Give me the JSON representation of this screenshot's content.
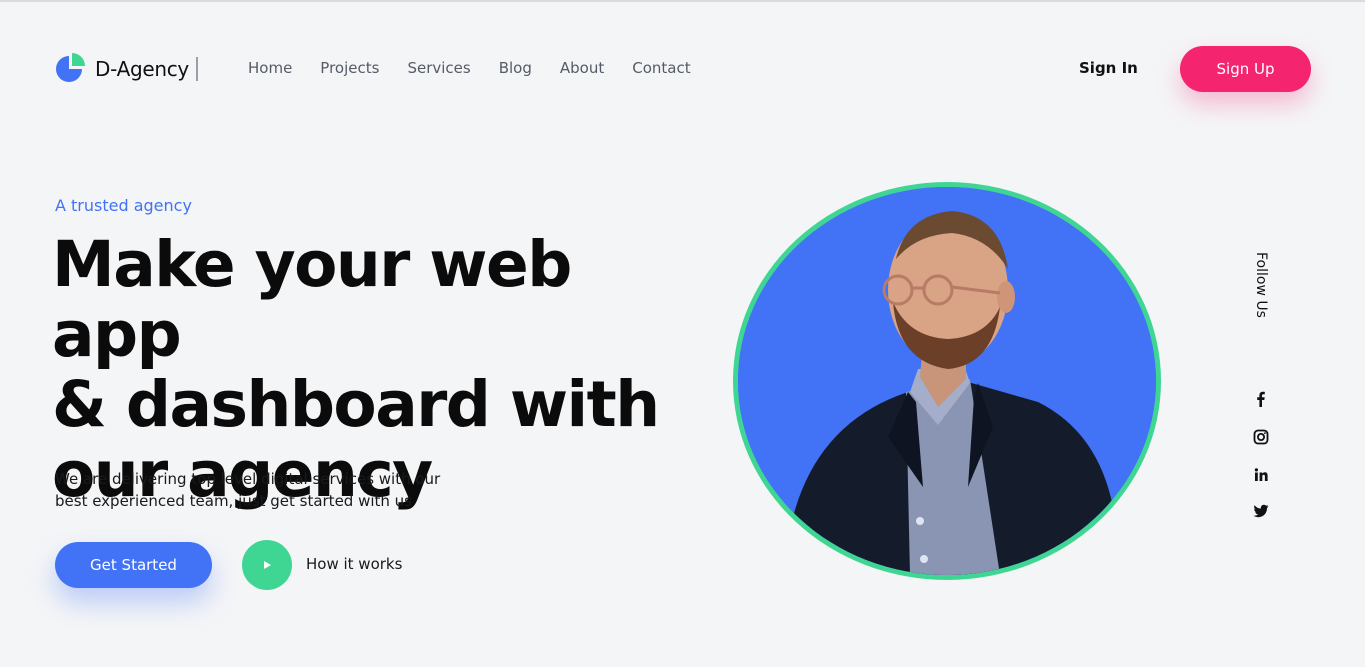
{
  "brand": {
    "name": "D-Agency",
    "primary": "#4272f5",
    "secondary": "#3fd694",
    "accent": "#f5246f"
  },
  "nav": {
    "items": [
      "Home",
      "Projects",
      "Services",
      "Blog",
      "About",
      "Contact"
    ]
  },
  "auth": {
    "signin_label": "Sign In",
    "signup_label": "Sign Up"
  },
  "hero": {
    "eyebrow": "A trusted agency",
    "headline_lines": [
      "Make your web app",
      "& dashboard with",
      "our agency"
    ],
    "subtext_lines": [
      "We are delivering top level digital services with our",
      "best experienced team, just get started with us"
    ],
    "cta_label": "Get Started",
    "secondary_label": "How it works",
    "image_icon": "person-photo"
  },
  "social": {
    "label": "Follow Us",
    "icons": [
      "facebook-icon",
      "instagram-icon",
      "linkedin-icon",
      "twitter-icon"
    ]
  }
}
